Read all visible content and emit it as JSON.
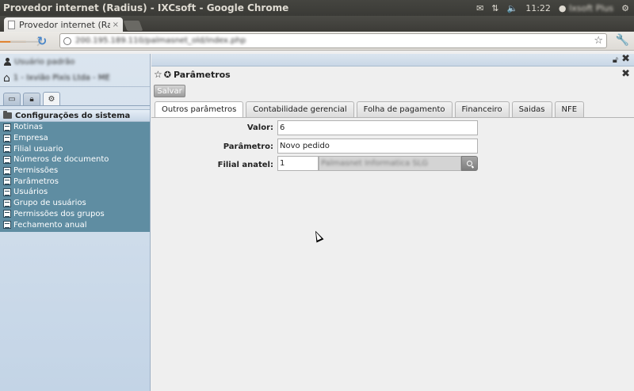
{
  "os_bar": {
    "window_title": "Provedor internet (Radius) - IXCsoft - Google Chrome",
    "clock": "11:22",
    "user_name": "Ixsoft Plus"
  },
  "browser": {
    "tab_title": "Provedor internet (Radius)",
    "tab_close": "×",
    "url": "200.195.189.110/palmasnet_old/index.php"
  },
  "sidebar": {
    "user": "Usuário padrão",
    "company": "1 - Ixvião Pixis Ltda - ME",
    "section_title": "Configurações do sistema",
    "items": [
      "Rotinas",
      "Empresa",
      "Filial usuario",
      "Números de documento",
      "Permissões",
      "Parâmetros",
      "Usuários",
      "Grupo de usuários",
      "Permissões dos grupos",
      "Fechamento anual"
    ]
  },
  "window": {
    "title": "Parâmetros",
    "save_label": "Salvar",
    "tabs": [
      "Outros parâmetros",
      "Contabilidade gerencial",
      "Folha de pagamento",
      "Financeiro",
      "Saidas",
      "NFE"
    ],
    "active_tab_index": 0,
    "form": {
      "valor_label": "Valor:",
      "valor_value": "6",
      "parametro_label": "Parâmetro:",
      "parametro_value": "Novo pedido",
      "filial_label": "Filial anatel:",
      "filial_id": "1",
      "filial_name": "Palmasnet Informatica SLG"
    }
  },
  "colors": {
    "menu_bg": "#5f8da2",
    "sidebar_bg": "#c3d4e6",
    "os_bar_bg": "#3c3b37",
    "back_arrow": "#e07a1f",
    "reload": "#4a86c8"
  }
}
